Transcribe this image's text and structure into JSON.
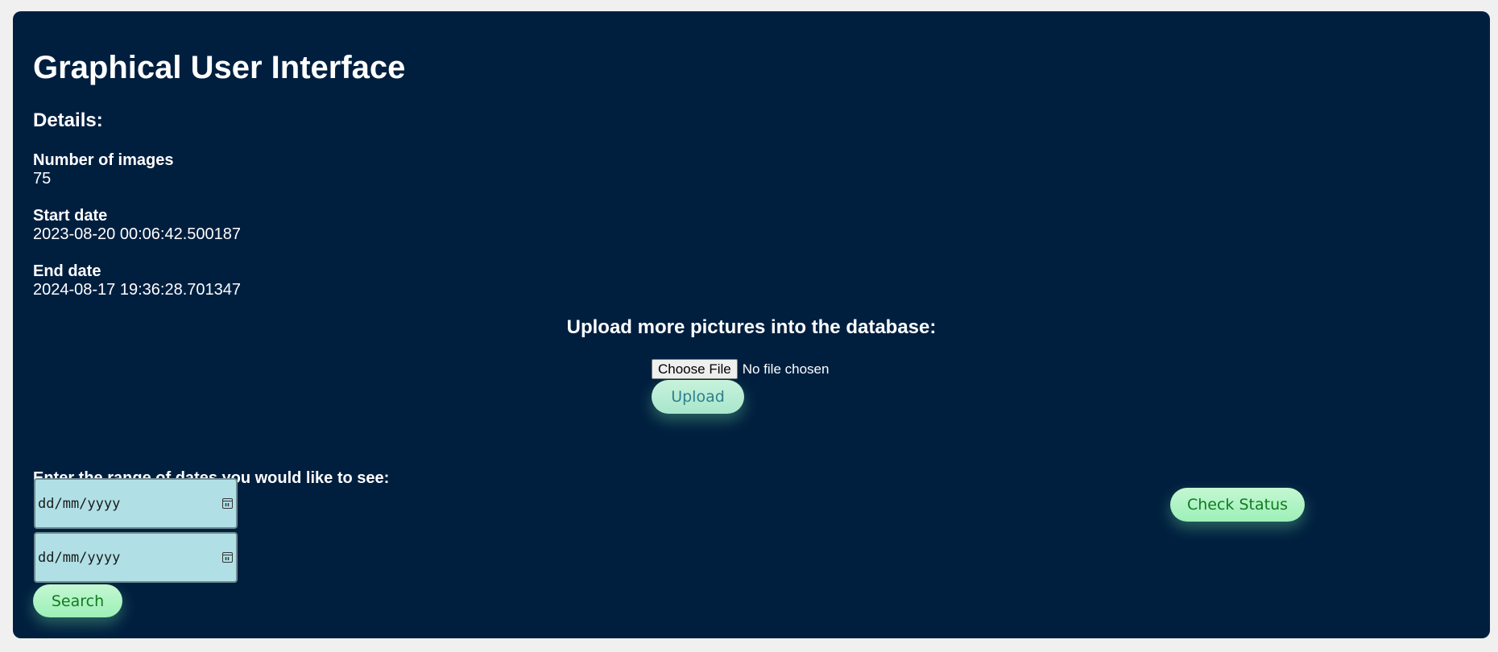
{
  "header": {
    "title": "Graphical User Interface",
    "details_heading": "Details:"
  },
  "details": {
    "images_label": "Number of images",
    "images_value": "75",
    "start_label": "Start date",
    "start_value": "2023-08-20 00:06:42.500187",
    "end_label": "End date",
    "end_value": "2024-08-17 19:36:28.701347"
  },
  "upload": {
    "heading": "Upload more pictures into the database:",
    "choose_file_label": "Choose File",
    "no_file_text": "No file chosen",
    "upload_label": "Upload"
  },
  "range": {
    "label": "Enter the range of dates you would like to see:",
    "start_placeholder": "dd/mm/yyyy",
    "end_placeholder": "dd/mm/yyyy",
    "search_label": "Search"
  },
  "status": {
    "check_label": "Check Status"
  },
  "colors": {
    "panel_bg": "#001f3f",
    "page_bg": "#f0f0f0",
    "date_input_bg": "#b0e0e6",
    "button_green": "#9cf0b8",
    "button_text_green": "#137a1f"
  },
  "icons": {
    "date_picker": "calendar-icon"
  }
}
